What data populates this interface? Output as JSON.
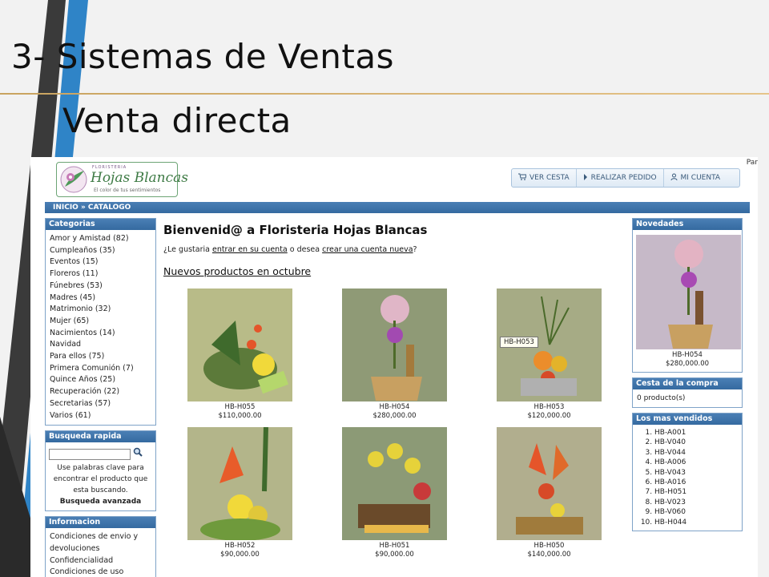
{
  "slide": {
    "title": "3- Sistemas de Ventas",
    "subtitle": "Venta directa"
  },
  "browser": {
    "edge_text": "Par"
  },
  "site": {
    "logo": {
      "small": "FLORISTERIA",
      "name": "Hojas Blancas",
      "tagline": "El color de tus sentimientos"
    },
    "topnav": [
      {
        "label": "VER CESTA",
        "icon": "cart-icon"
      },
      {
        "label": "REALIZAR PEDIDO",
        "icon": "arrow-right-icon"
      },
      {
        "label": "MI CUENTA",
        "icon": "user-icon"
      }
    ],
    "breadcrumb": "INICIO » CATALOGO"
  },
  "categories": {
    "title": "Categorias",
    "items": [
      "Amor y Amistad (82)",
      "Cumpleaños (35)",
      "Eventos (15)",
      "Floreros (11)",
      "Fúnebres (53)",
      "Madres (45)",
      "Matrimonio (32)",
      "Mujer (65)",
      "Nacimientos (14)",
      "Navidad",
      "Para ellos (75)",
      "Primera Comunión (7)",
      "Quince Años (25)",
      "Recuperación (22)",
      "Secretarias (57)",
      "Varios (61)"
    ]
  },
  "quick_search": {
    "title": "Busqueda rapida",
    "input_value": "",
    "help": "Use palabras clave para encontrar el producto que esta buscando.",
    "advanced": "Busqueda avanzada"
  },
  "info": {
    "title": "Informacion",
    "items": [
      "Condiciones de envio y devoluciones",
      "Confidencialidad",
      "Condiciones de uso"
    ]
  },
  "main": {
    "welcome": "Bienvenid@ a Floristeria Hojas Blancas",
    "account_prefix": "¿Le gustaria ",
    "account_login": "entrar en su cuenta",
    "account_middle": " o desea ",
    "account_create": "crear una cuenta nueva",
    "account_suffix": "?",
    "new_products": "Nuevos productos en octubre",
    "tooltip": "HB-H053",
    "products": [
      {
        "code": "HB-H055",
        "price": "$110,000.00"
      },
      {
        "code": "HB-H054",
        "price": "$280,000.00"
      },
      {
        "code": "HB-H053",
        "price": "$120,000.00"
      },
      {
        "code": "HB-H052",
        "price": "$90,000.00"
      },
      {
        "code": "HB-H051",
        "price": "$90,000.00"
      },
      {
        "code": "HB-H050",
        "price": "$140,000.00"
      }
    ]
  },
  "novedades": {
    "title": "Novedades",
    "code": "HB-H054",
    "price": "$280,000.00"
  },
  "cart": {
    "title": "Cesta de la compra",
    "text": "0 producto(s)"
  },
  "bestsellers": {
    "title": "Los mas vendidos",
    "items": [
      "HB-A001",
      "HB-V040",
      "HB-V044",
      "HB-A006",
      "HB-V043",
      "HB-A016",
      "HB-H051",
      "HB-V023",
      "HB-V060",
      "HB-H044"
    ]
  },
  "colors": {
    "panel_header": "#356aa0",
    "logo_green": "#3d7a44",
    "title_rule": "#c9a35f"
  }
}
